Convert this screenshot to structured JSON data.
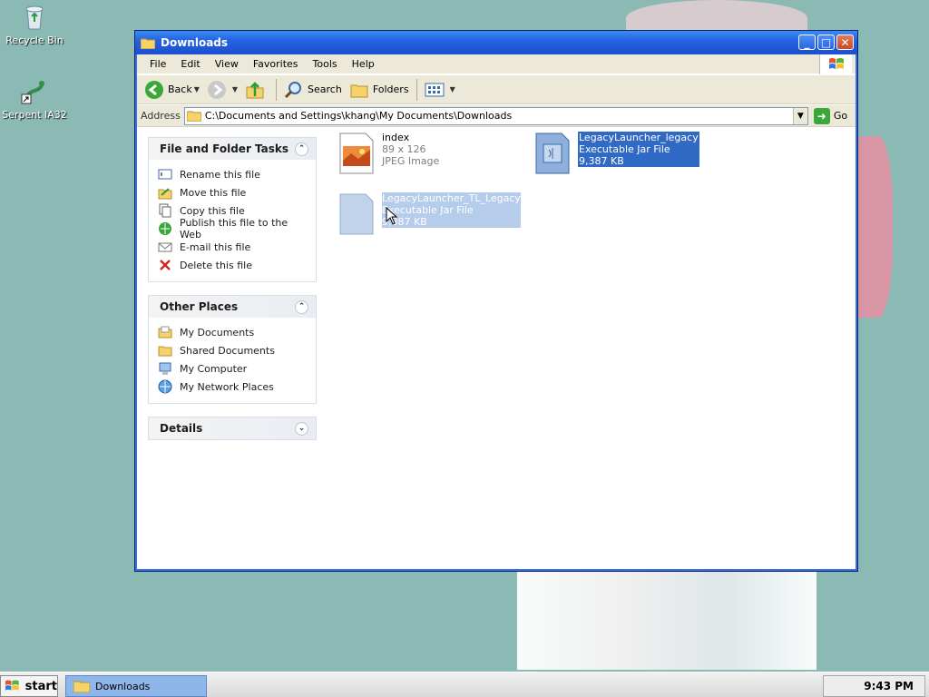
{
  "desktop": {
    "icons": [
      {
        "label": "Recycle Bin"
      },
      {
        "label": "Serpent IA32"
      }
    ]
  },
  "window": {
    "title": "Downloads",
    "controls": {
      "minimize": "_",
      "maximize": "□",
      "close": "✕"
    },
    "menu": [
      "File",
      "Edit",
      "View",
      "Favorites",
      "Tools",
      "Help"
    ],
    "toolbar": {
      "back": "Back",
      "search": "Search",
      "folders": "Folders"
    },
    "address": {
      "label": "Address",
      "value": "C:\\Documents and Settings\\khang\\My Documents\\Downloads",
      "go": "Go"
    },
    "taskpane": {
      "file_tasks": {
        "title": "File and Folder Tasks",
        "items": [
          "Rename this file",
          "Move this file",
          "Copy this file",
          "Publish this file to the Web",
          "E-mail this file",
          "Delete this file"
        ]
      },
      "other_places": {
        "title": "Other Places",
        "items": [
          "My Documents",
          "Shared Documents",
          "My Computer",
          "My Network Places"
        ]
      },
      "details": {
        "title": "Details"
      }
    },
    "files": [
      {
        "name": "index",
        "line2": "89 x 126",
        "line3": "JPEG Image",
        "selected": false
      },
      {
        "name": "LegacyLauncher_legacy",
        "line2": "Executable Jar File",
        "line3": "9,387 KB",
        "selected": true
      }
    ],
    "drag_ghost": {
      "name": "LegacyLauncher_TL_Legacy",
      "line2": "Executable Jar File",
      "line3": "9,387 KB"
    }
  },
  "taskbar": {
    "start": "start",
    "task": "Downloads",
    "clock": "9:43 PM"
  },
  "colors": {
    "desktop": "#8bb9b3",
    "titlebar": "#2563e0",
    "selection": "#316ac5"
  }
}
